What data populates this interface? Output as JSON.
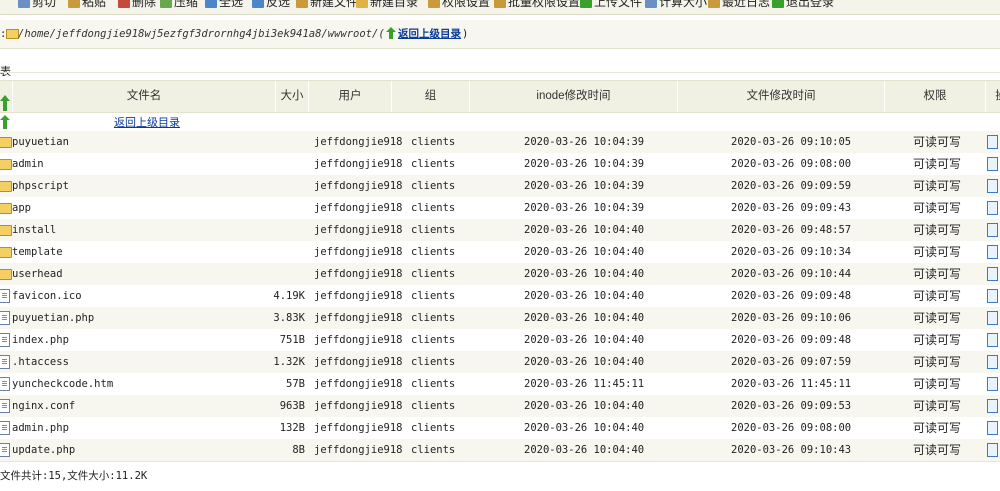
{
  "toolbar": {
    "items": [
      "剪切",
      "粘贴",
      "删除",
      "压缩",
      "全选",
      "反选",
      "新建文件",
      "新建目录",
      "权限设置",
      "批量权限设置",
      "上传文件",
      "计算大小",
      "最近日志",
      "退出登录"
    ]
  },
  "path": {
    "prefix": ":",
    "value": "/home/jeffdongjie918wj5ezfgf3drornhg4jbi3ek941a8/wwwroot/(",
    "up_link": "返回上级目录",
    "close_paren": ")"
  },
  "section_title": "表",
  "table": {
    "headers": {
      "name": "文件名",
      "size": "大小",
      "user": "用户",
      "group": "组",
      "inode": "inode修改时间",
      "mtime": "文件修改时间",
      "perm": "权限",
      "ops": "操"
    },
    "up_link": "返回上级目录",
    "rows": [
      {
        "type": "folder",
        "name": "puyuetian",
        "size": "",
        "user": "jeffdongjie918",
        "group": "clients",
        "inode": "2020-03-26 10:04:39",
        "mtime": "2020-03-26 09:10:05",
        "perm": "可读可写"
      },
      {
        "type": "folder",
        "name": "admin",
        "size": "",
        "user": "jeffdongjie918",
        "group": "clients",
        "inode": "2020-03-26 10:04:39",
        "mtime": "2020-03-26 09:08:00",
        "perm": "可读可写"
      },
      {
        "type": "folder",
        "name": "phpscript",
        "size": "",
        "user": "jeffdongjie918",
        "group": "clients",
        "inode": "2020-03-26 10:04:39",
        "mtime": "2020-03-26 09:09:59",
        "perm": "可读可写"
      },
      {
        "type": "folder",
        "name": "app",
        "size": "",
        "user": "jeffdongjie918",
        "group": "clients",
        "inode": "2020-03-26 10:04:39",
        "mtime": "2020-03-26 09:09:43",
        "perm": "可读可写"
      },
      {
        "type": "folder",
        "name": "install",
        "size": "",
        "user": "jeffdongjie918",
        "group": "clients",
        "inode": "2020-03-26 10:04:40",
        "mtime": "2020-03-26 09:48:57",
        "perm": "可读可写"
      },
      {
        "type": "folder",
        "name": "template",
        "size": "",
        "user": "jeffdongjie918",
        "group": "clients",
        "inode": "2020-03-26 10:04:40",
        "mtime": "2020-03-26 09:10:34",
        "perm": "可读可写"
      },
      {
        "type": "folder",
        "name": "userhead",
        "size": "",
        "user": "jeffdongjie918",
        "group": "clients",
        "inode": "2020-03-26 10:04:40",
        "mtime": "2020-03-26 09:10:44",
        "perm": "可读可写"
      },
      {
        "type": "file",
        "name": "favicon.ico",
        "size": "4.19K",
        "user": "jeffdongjie918",
        "group": "clients",
        "inode": "2020-03-26 10:04:40",
        "mtime": "2020-03-26 09:09:48",
        "perm": "可读可写"
      },
      {
        "type": "file",
        "name": "puyuetian.php",
        "size": "3.83K",
        "user": "jeffdongjie918",
        "group": "clients",
        "inode": "2020-03-26 10:04:40",
        "mtime": "2020-03-26 09:10:06",
        "perm": "可读可写"
      },
      {
        "type": "file",
        "name": "index.php",
        "size": "751B",
        "user": "jeffdongjie918",
        "group": "clients",
        "inode": "2020-03-26 10:04:40",
        "mtime": "2020-03-26 09:09:48",
        "perm": "可读可写"
      },
      {
        "type": "file",
        "name": ".htaccess",
        "size": "1.32K",
        "user": "jeffdongjie918",
        "group": "clients",
        "inode": "2020-03-26 10:04:40",
        "mtime": "2020-03-26 09:07:59",
        "perm": "可读可写"
      },
      {
        "type": "file",
        "name": "yuncheckcode.htm",
        "size": "57B",
        "user": "jeffdongjie918",
        "group": "clients",
        "inode": "2020-03-26 11:45:11",
        "mtime": "2020-03-26 11:45:11",
        "perm": "可读可写"
      },
      {
        "type": "file",
        "name": "nginx.conf",
        "size": "963B",
        "user": "jeffdongjie918",
        "group": "clients",
        "inode": "2020-03-26 10:04:40",
        "mtime": "2020-03-26 09:09:53",
        "perm": "可读可写"
      },
      {
        "type": "file",
        "name": "admin.php",
        "size": "132B",
        "user": "jeffdongjie918",
        "group": "clients",
        "inode": "2020-03-26 10:04:40",
        "mtime": "2020-03-26 09:08:00",
        "perm": "可读可写"
      },
      {
        "type": "file",
        "name": "update.php",
        "size": "8B",
        "user": "jeffdongjie918",
        "group": "clients",
        "inode": "2020-03-26 10:04:40",
        "mtime": "2020-03-26 09:10:43",
        "perm": "可读可写"
      }
    ]
  },
  "footer": "文件共计:15,文件大小:11.2K"
}
